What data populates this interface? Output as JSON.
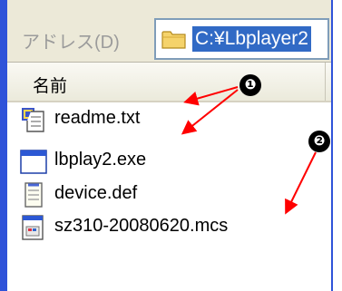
{
  "address_bar": {
    "label": "アドレス(D)",
    "value": "C:¥Lbplayer2",
    "folder_icon": "folder-icon"
  },
  "file_list": {
    "column_header": "名前",
    "files": [
      {
        "name": "readme.txt",
        "icon": "text-document-icon"
      },
      {
        "name": "lbplay2.exe",
        "icon": "application-window-icon"
      },
      {
        "name": "device.def",
        "icon": "notepad-file-icon"
      },
      {
        "name": "sz310-20080620.mcs",
        "icon": "data-file-icon"
      }
    ]
  },
  "annotations": {
    "marker_1": "❶",
    "marker_2": "❷"
  },
  "colors": {
    "window_border": "#2f53d9",
    "selection": "#316ac5",
    "arrow": "#ff0000"
  }
}
